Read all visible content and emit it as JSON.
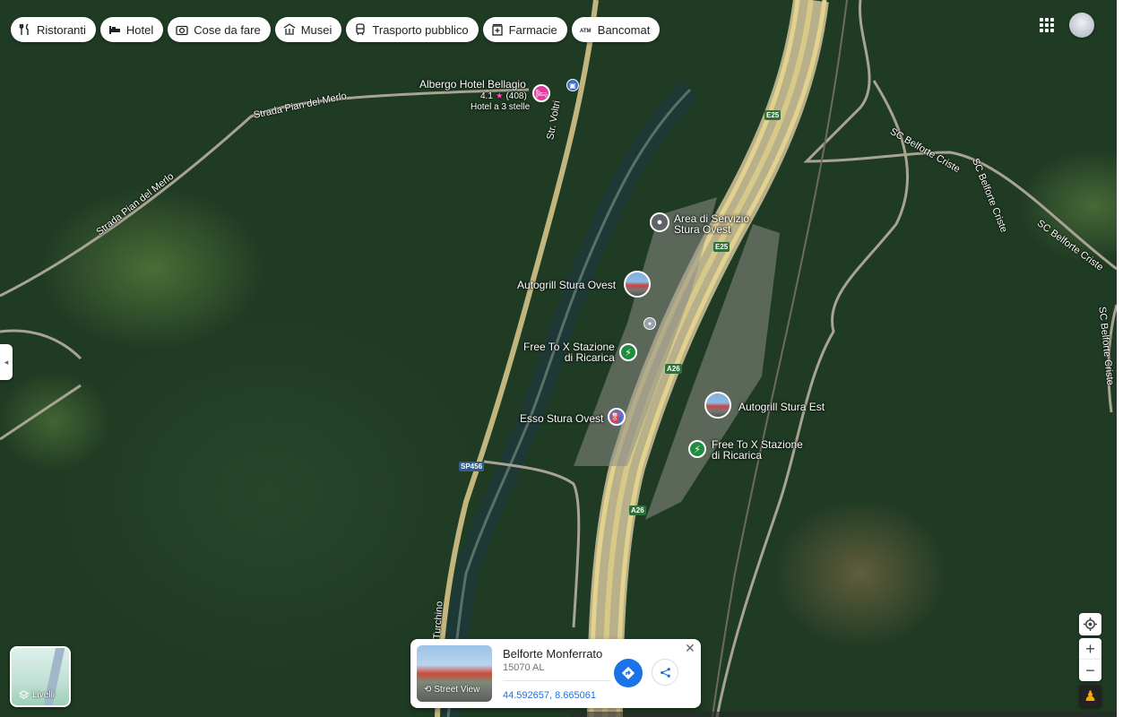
{
  "categories": [
    {
      "label": "Ristoranti",
      "icon": "fork-knife-icon"
    },
    {
      "label": "Hotel",
      "icon": "bed-icon"
    },
    {
      "label": "Cose da fare",
      "icon": "camera-icon"
    },
    {
      "label": "Musei",
      "icon": "museum-icon"
    },
    {
      "label": "Trasporto pubblico",
      "icon": "train-icon"
    },
    {
      "label": "Farmacie",
      "icon": "pharmacy-icon"
    },
    {
      "label": "Bancomat",
      "icon": "atm-icon"
    }
  ],
  "roads": {
    "strada_pian_1": "Strada Pian del Merlo",
    "strada_pian_2": "Strada Pian del Merlo",
    "str_voltri": "Str. Voltri",
    "sc_belforte_1": "SC Belforte Criste",
    "sc_belforte_2": "SC Belforte Criste",
    "sc_belforte_3": "SC Belforte Criste",
    "sc_belforte_4": "SC Belforte Criste",
    "turchino": "Turchino",
    "e25_a": "E25",
    "e25_b": "E25",
    "a26_a": "A26",
    "a26_b": "A26",
    "sp456": "SP456"
  },
  "pois": {
    "hotel": {
      "name": "Albergo Hotel Bellagio",
      "rating": "4.1",
      "reviews": "(408)",
      "type": "Hotel a 3 stelle"
    },
    "area_servizio": {
      "line1": "Area di Servizio",
      "line2": "Stura Ovest"
    },
    "autogrill_ovest": "Autogrill Stura Ovest",
    "free_to_x_1": {
      "line1": "Free To X Stazione",
      "line2": "di Ricarica"
    },
    "esso": "Esso Stura Ovest",
    "autogrill_est": "Autogrill Stura Est",
    "free_to_x_2": {
      "line1": "Free To X Stazione",
      "line2": "di Ricarica"
    }
  },
  "layers": {
    "label": "Livelli"
  },
  "card": {
    "title": "Belforte Monferrato",
    "postal": "15070 AL",
    "coords": "44.592657, 8.665061",
    "street_view": "Street View"
  },
  "controls": {
    "zoom_in": "+",
    "zoom_out": "−"
  }
}
